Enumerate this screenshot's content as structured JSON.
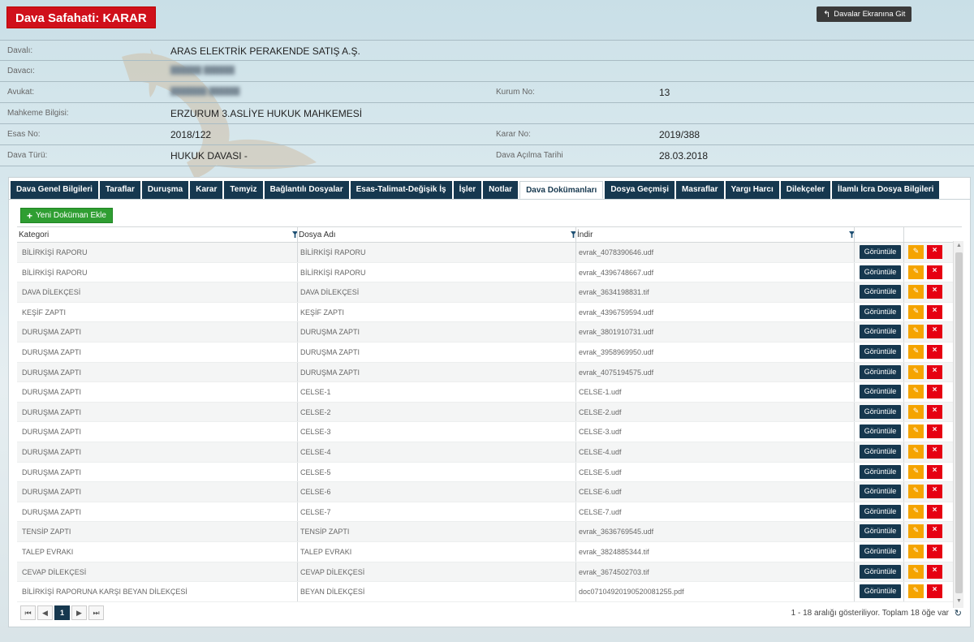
{
  "page": {
    "title": "Dava Safahati: KARAR",
    "back_button": "Davalar Ekranına Git"
  },
  "info": {
    "rows": [
      {
        "l1": "Davalı:",
        "v1": "ARAS ELEKTRİK PERAKENDE SATIŞ A.Ş.",
        "l2": "",
        "v2": ""
      },
      {
        "l1": "Davacı:",
        "v1": "",
        "l2": "",
        "v2": ""
      },
      {
        "l1": "Avukat:",
        "v1": "",
        "l2": "Kurum No:",
        "v2": "13"
      },
      {
        "l1": "Mahkeme Bilgisi:",
        "v1": "ERZURUM 3.ASLİYE HUKUK MAHKEMESİ",
        "l2": "",
        "v2": ""
      },
      {
        "l1": "Esas No:",
        "v1": "2018/122",
        "l2": "Karar No:",
        "v2": "2019/388"
      },
      {
        "l1": "Dava Türü:",
        "v1": "HUKUK DAVASI -",
        "l2": "Dava Açılma Tarihi",
        "v2": "28.03.2018"
      }
    ]
  },
  "tabs": [
    "Dava Genel Bilgileri",
    "Taraflar",
    "Duruşma",
    "Karar",
    "Temyiz",
    "Bağlantılı Dosyalar",
    "Esas-Talimat-Değişik İş",
    "İşler",
    "Notlar",
    "Dava Dokümanları",
    "Dosya Geçmişi",
    "Masraflar",
    "Yargı Harcı",
    "Dilekçeler",
    "İlamlı İcra Dosya Bilgileri"
  ],
  "active_tab": "Dava Dokümanları",
  "add_button": "Yeni Doküman Ekle",
  "columns": [
    "Kategori",
    "Dosya Adı",
    "İndir"
  ],
  "view_label": "Görüntüle",
  "documents": [
    {
      "kategori": "BİLİRKİŞİ RAPORU",
      "dosya": "BİLİRKİŞİ RAPORU",
      "indir": "evrak_4078390646.udf"
    },
    {
      "kategori": "BİLİRKİŞİ RAPORU",
      "dosya": "BİLİRKİŞİ RAPORU",
      "indir": "evrak_4396748667.udf"
    },
    {
      "kategori": "DAVA DİLEKÇESİ",
      "dosya": "DAVA DİLEKÇESİ",
      "indir": "evrak_3634198831.tif"
    },
    {
      "kategori": "KEŞİF ZAPTI",
      "dosya": "KEŞİF ZAPTI",
      "indir": "evrak_4396759594.udf"
    },
    {
      "kategori": "DURUŞMA ZAPTI",
      "dosya": "DURUŞMA ZAPTI",
      "indir": "evrak_3801910731.udf"
    },
    {
      "kategori": "DURUŞMA ZAPTI",
      "dosya": "DURUŞMA ZAPTI",
      "indir": "evrak_3958969950.udf"
    },
    {
      "kategori": "DURUŞMA ZAPTI",
      "dosya": "DURUŞMA ZAPTI",
      "indir": "evrak_4075194575.udf"
    },
    {
      "kategori": "DURUŞMA ZAPTI",
      "dosya": "CELSE-1",
      "indir": "CELSE-1.udf"
    },
    {
      "kategori": "DURUŞMA ZAPTI",
      "dosya": "CELSE-2",
      "indir": "CELSE-2.udf"
    },
    {
      "kategori": "DURUŞMA ZAPTI",
      "dosya": "CELSE-3",
      "indir": "CELSE-3.udf"
    },
    {
      "kategori": "DURUŞMA ZAPTI",
      "dosya": "CELSE-4",
      "indir": "CELSE-4.udf"
    },
    {
      "kategori": "DURUŞMA ZAPTI",
      "dosya": "CELSE-5",
      "indir": "CELSE-5.udf"
    },
    {
      "kategori": "DURUŞMA ZAPTI",
      "dosya": "CELSE-6",
      "indir": "CELSE-6.udf"
    },
    {
      "kategori": "DURUŞMA ZAPTI",
      "dosya": "CELSE-7",
      "indir": "CELSE-7.udf"
    },
    {
      "kategori": "TENSİP ZAPTI",
      "dosya": "TENSİP ZAPTI",
      "indir": "evrak_3636769545.udf"
    },
    {
      "kategori": "TALEP EVRAKI",
      "dosya": "TALEP EVRAKI",
      "indir": "evrak_3824885344.tif"
    },
    {
      "kategori": "CEVAP DİLEKÇESİ",
      "dosya": "CEVAP DİLEKÇESİ",
      "indir": "evrak_3674502703.tif"
    },
    {
      "kategori": "BİLİRKİŞİ RAPORUNA KARŞI BEYAN DİLEKÇESİ",
      "dosya": "BEYAN DİLEKÇESİ",
      "indir": "doc07104920190520081255.pdf"
    }
  ],
  "pager": {
    "current_page": "1",
    "info": "1 - 18 aralığı gösteriliyor. Toplam 18 öğe var"
  },
  "icons": {
    "back": "arrow-back-icon",
    "add": "plus-icon",
    "filter": "filter-icon",
    "edit": "pencil-icon",
    "delete": "close-icon",
    "refresh": "refresh-icon"
  }
}
